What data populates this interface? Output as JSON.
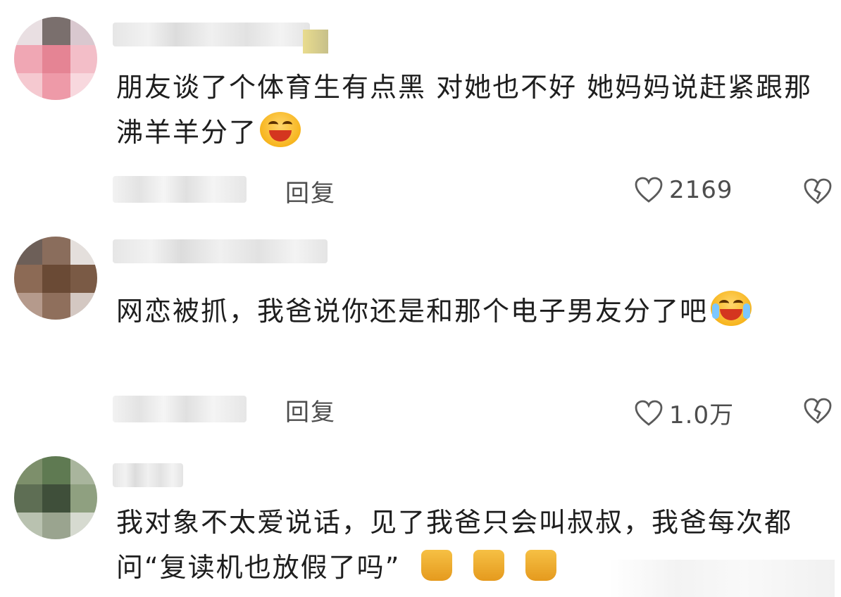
{
  "comments": [
    {
      "text": "朋友谈了个体育生有点黑  对她也不好  她妈妈说赶紧跟那沸羊羊分了",
      "emoji_icon": "laughing-emoji-icon",
      "reply_label": "回复",
      "like_count": "2169"
    },
    {
      "text": "网恋被抓，我爸说你还是和那个电子男友分了吧",
      "emoji_icon": "tears-of-joy-emoji-icon",
      "reply_label": "回复",
      "like_count": "1.0万"
    },
    {
      "text": "我对象不太爱说话，见了我爸只会叫叔叔，我爸每次都问“复读机也放假了吗”",
      "emoji_icon": "cat-emoji-icon"
    }
  ],
  "icons": {
    "like": "heart-outline-icon",
    "dislike": "broken-heart-icon"
  },
  "colors": {
    "background": "#ffffff",
    "text": "#1e1e1e",
    "secondary_text": "#4d4d4d",
    "emoji_yellow": "#f7b51e"
  }
}
